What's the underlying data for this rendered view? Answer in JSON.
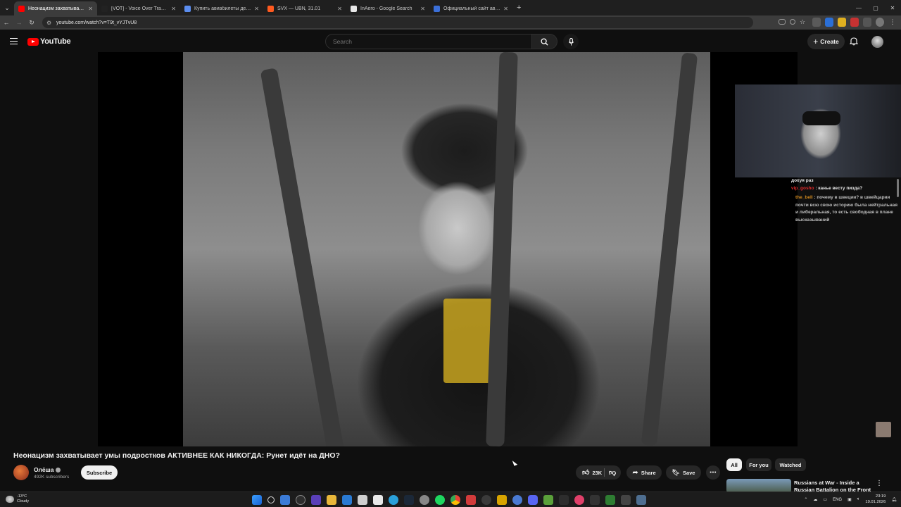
{
  "browser": {
    "tabs": [
      {
        "title": "Неонацизм захватывает умы подростков",
        "active": true,
        "color": "#ff0000"
      },
      {
        "title": "[VOT] - Voice Over Translation",
        "active": false,
        "color": "#222222"
      },
      {
        "title": "Купить авиабилеты дешево онлайн",
        "active": false,
        "color": "#5b8def"
      },
      {
        "title": "SVX — UBN, 31.01",
        "active": false,
        "color": "#ff5a1f"
      },
      {
        "title": "InAero - Google Search",
        "active": false,
        "color": "#e8e8e8"
      },
      {
        "title": "Официальный сайт авиакомпании",
        "active": false,
        "color": "#3b6fd8"
      }
    ],
    "url": "youtube.com/watch?v=T9t_vYJTvU8"
  },
  "youtube": {
    "logo_text": "YouTube",
    "search_placeholder": "Search",
    "create_label": "Create"
  },
  "video": {
    "title": "Неонацизм захватывает умы подростков АКТИВНЕЕ КАК НИКОГДА: Рунет идёт на ДНО?",
    "channel_name": "Олёша",
    "subscribers": "492K subscribers",
    "subscribe_label": "Subscribe",
    "likes": "23K",
    "share_label": "Share",
    "save_label": "Save"
  },
  "stream_chat": [
    {
      "user": "",
      "text": "дохуя раз",
      "user_color": "#e6e6e6"
    },
    {
      "user": "vip_gosho",
      "text": ": канье весту пизда?",
      "user_color": "#e02b2b"
    },
    {
      "user": "the_bell",
      "text": ": почему в швеции? в швейцарии почти всю свою историю была нейтральная и либеральная, то есть свободная в плане высказываний",
      "user_color": "#d28a1e"
    }
  ],
  "sidebar": {
    "chips": [
      "All",
      "For you",
      "Watched"
    ],
    "recommendation_title": "Russians at War - Inside a Russian Battalion on the Front"
  },
  "taskbar": {
    "weather_temp": "-13°C",
    "weather_desc": "Cloudy",
    "language": "ENG",
    "time": "23:19",
    "date": "19.01.2026"
  }
}
